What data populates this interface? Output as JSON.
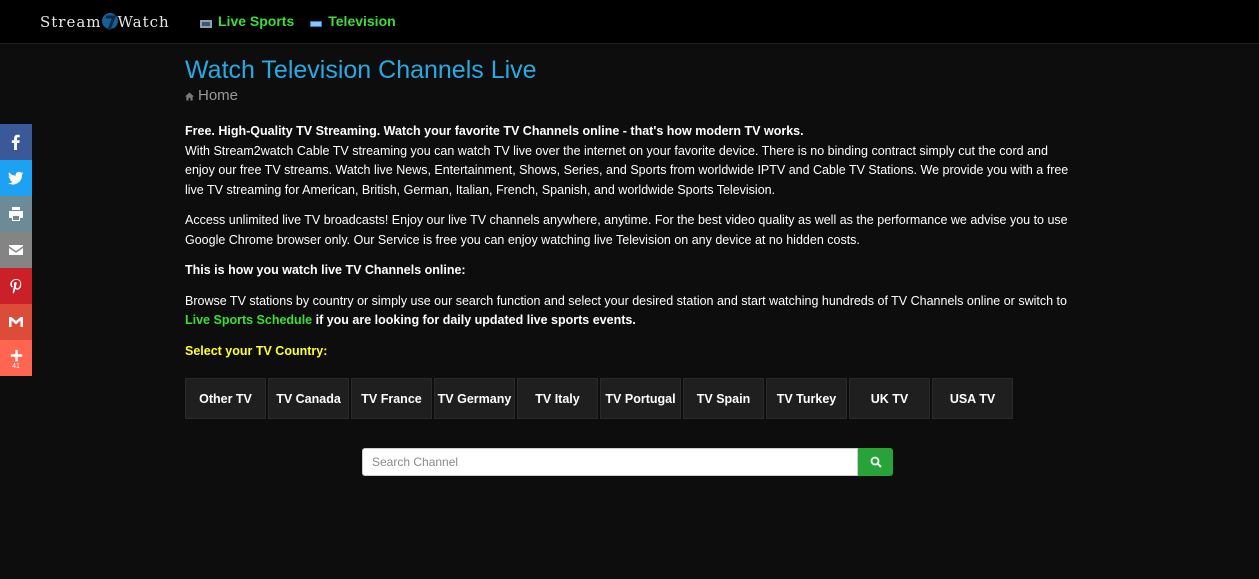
{
  "brand": {
    "left": "Stream",
    "right": "Watch"
  },
  "nav": [
    {
      "label": "Live Sports",
      "icon": "sports-icon"
    },
    {
      "label": "Television",
      "icon": "tv-icon"
    }
  ],
  "share": [
    {
      "name": "facebook",
      "color": "#3b5998"
    },
    {
      "name": "twitter",
      "color": "#1da1f2"
    },
    {
      "name": "print",
      "color": "#6d8a97"
    },
    {
      "name": "email",
      "color": "#848484"
    },
    {
      "name": "pinterest",
      "color": "#cb2027"
    },
    {
      "name": "gmail",
      "color": "#dd4b39"
    },
    {
      "name": "more",
      "color": "#ff6550",
      "count": "41"
    }
  ],
  "page": {
    "title": "Watch Television Channels Live",
    "breadcrumb": "Home"
  },
  "content": {
    "intro_bold": "Free. High-Quality TV Streaming. Watch your favorite TV Channels online - that's how modern TV works.",
    "intro_text": "With Stream2watch Cable TV streaming you can watch TV live over the internet on your favorite device. There is no binding contract simply cut the cord and enjoy our free TV streams. Watch live News, Entertainment, Shows, Series, and Sports from worldwide IPTV and Cable TV Stations. We provide you with a free live TV streaming for American, British, German, Italian, French, Spanish, and worldwide Sports Television.",
    "access_text": "Access unlimited live TV broadcasts! Enjoy our live TV channels anywhere, anytime. For the best video quality as well as the performance we advise you to use Google Chrome browser only. Our Service is free you can enjoy watching live Television on any device at no hidden costs.",
    "howto_heading": "This is how you watch live TV Channels online:",
    "browse_text": "Browse TV stations by country or simply use our search function and select your desired station and start watching hundreds of TV Channels online or switch to ",
    "browse_link": "Live Sports Schedule",
    "browse_tail": " if you are looking for daily updated live sports events.",
    "select_label": "Select your TV Country:"
  },
  "countries": [
    "Other TV",
    "TV Canada",
    "TV France",
    "TV Germany",
    "TV Italy",
    "TV Portugal",
    "TV Spain",
    "TV Turkey",
    "UK TV",
    "USA TV"
  ],
  "search": {
    "placeholder": "Search Channel"
  },
  "colors": {
    "title": "#28a9e2",
    "link_green": "#3adf36",
    "label_yellow": "#ffff2d",
    "search_button": "#27a33a"
  }
}
